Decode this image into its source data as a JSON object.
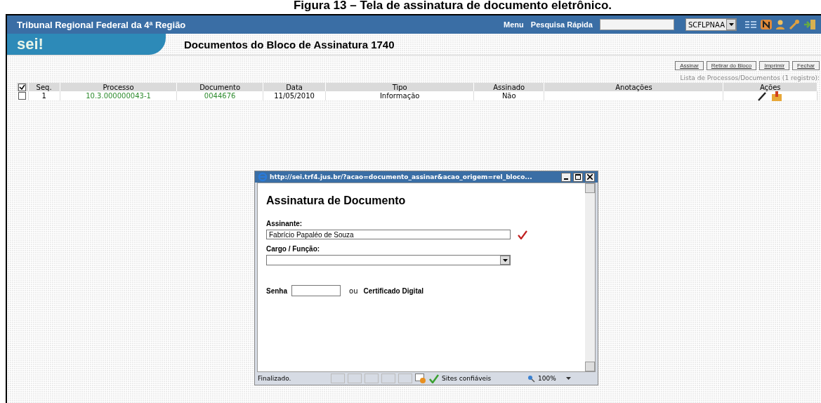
{
  "caption": "Figura 13 – Tela de assinatura de documento eletrônico.",
  "header": {
    "organization": "Tribunal Regional Federal da 4ª Região",
    "menu": "Menu",
    "quick_search_label": "Pesquisa Rápida",
    "unit": "SCFLPNAA"
  },
  "logo": "sei!",
  "page_title": "Documentos do Bloco de Assinatura 1740",
  "actions": [
    "Assinar",
    "Retirar do Bloco",
    "Imprimir",
    "Fechar"
  ],
  "table": {
    "caption": "Lista de Processos/Documentos (1 registro):",
    "select_all_checked": true,
    "columns": [
      "Seq.",
      "Processo",
      "Documento",
      "Data",
      "Tipo",
      "Assinado",
      "Anotações",
      "Ações"
    ],
    "rows": [
      {
        "checked": false,
        "seq": "1",
        "processo": "10.3.000000043-1",
        "documento": "0044676",
        "data": "11/05/2010",
        "tipo": "Informação",
        "assinado": "Não",
        "anotacoes": ""
      }
    ]
  },
  "dialog": {
    "url": "http://sei.trf4.jus.br/?acao=documento_assinar&acao_origem=rel_bloco...",
    "title": "Assinatura de Documento",
    "signer_label": "Assinante:",
    "signer_value": "Fabrício Papaléo de Souza",
    "signer_valid": true,
    "role_label": "Cargo / Função:",
    "password_label": "Senha",
    "or": "ou",
    "certificate": "Certificado Digital",
    "status": "Finalizado.",
    "zone": "Sites confiáveis",
    "zoom": "100%"
  }
}
